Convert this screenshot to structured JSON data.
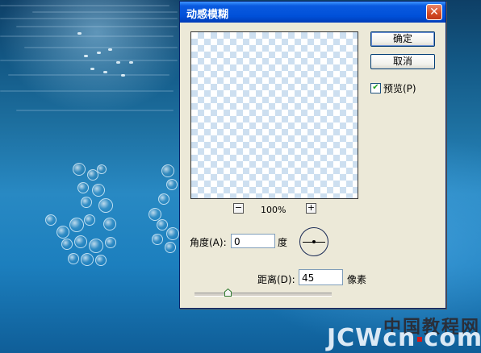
{
  "dialog": {
    "title": "动感模糊",
    "close_label": "✕",
    "ok_label": "确定",
    "cancel_label": "取消",
    "preview_label": "预览(P)",
    "preview_checked": true,
    "zoom_out_label": "−",
    "zoom_in_label": "+",
    "zoom_level": "100%",
    "angle_label": "角度(A):",
    "angle_value": "0",
    "angle_unit": "度",
    "distance_label": "距离(D):",
    "distance_value": "45",
    "distance_unit": "像素"
  },
  "watermark": {
    "chinese": "中国教程网",
    "latin_left": "JCWcn",
    "latin_right": "com"
  },
  "colors": {
    "titlebar": "#0050d8",
    "dialog_bg": "#ece9d8",
    "checkmark": "#21a121",
    "watermark_dot": "#d21a1a"
  }
}
